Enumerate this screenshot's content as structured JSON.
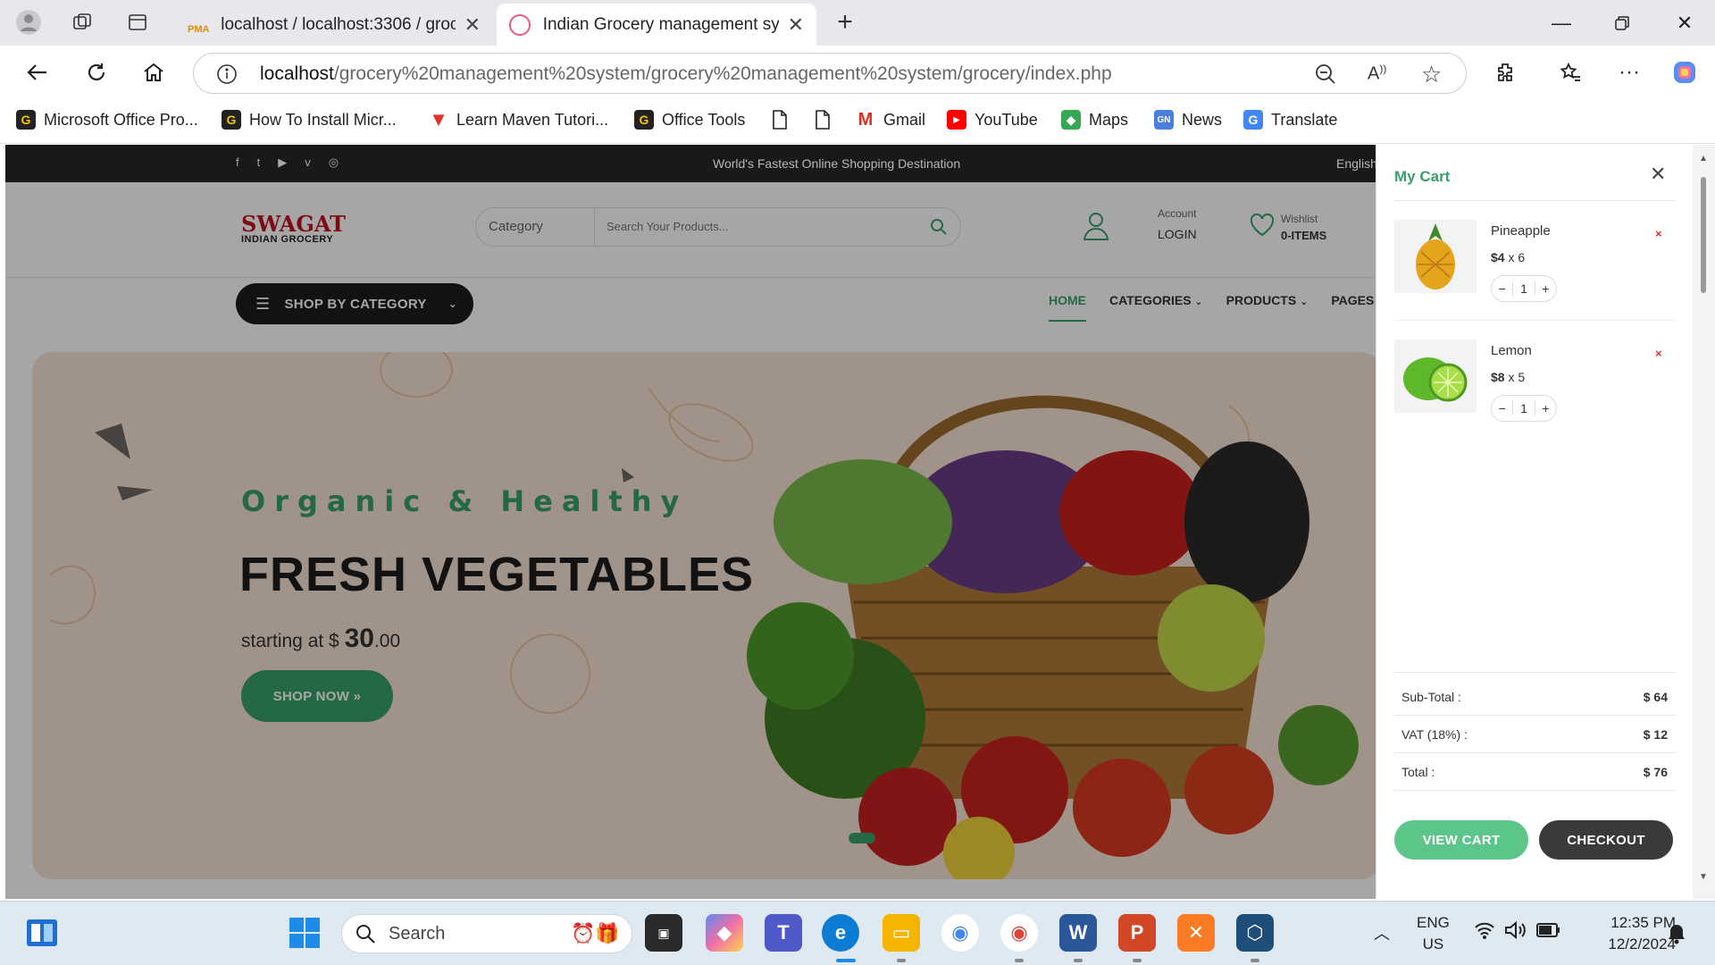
{
  "browser": {
    "tabs": [
      {
        "title": "localhost / localhost:3306 / groce"
      },
      {
        "title": "Indian Grocery management syste"
      }
    ],
    "url_host": "localhost",
    "url_path": "/grocery%20management%20system/grocery%20management%20system/grocery/index.php",
    "bookmarks": [
      {
        "label": "Microsoft Office Pro...",
        "icon": "g-icon"
      },
      {
        "label": "How To Install Micr...",
        "icon": "g-icon"
      },
      {
        "label": "Learn Maven Tutori...",
        "icon": "v-icon"
      },
      {
        "label": "Office Tools",
        "icon": "g-icon"
      },
      {
        "label": "",
        "icon": "file-icon"
      },
      {
        "label": "",
        "icon": "file-icon"
      },
      {
        "label": "Gmail",
        "icon": "gmail-icon"
      },
      {
        "label": "YouTube",
        "icon": "youtube-icon"
      },
      {
        "label": "Maps",
        "icon": "maps-icon"
      },
      {
        "label": "News",
        "icon": "news-icon"
      },
      {
        "label": "Translate",
        "icon": "translate-icon"
      }
    ]
  },
  "site": {
    "tagline": "World's Fastest Online Shopping Destination",
    "language": "English",
    "logo_main": "SWAGAT",
    "logo_sub": "INDIAN GROCERY",
    "search_category": "Category",
    "search_placeholder": "Search Your Products...",
    "account_label": "Account",
    "account_action": "LOGIN",
    "wishlist_label": "Wishlist",
    "wishlist_count": "0-ITEMS",
    "shop_by_category": "SHOP BY CATEGORY",
    "nav": [
      {
        "label": "HOME"
      },
      {
        "label": "CATEGORIES"
      },
      {
        "label": "PRODUCTS"
      },
      {
        "label": "PAGES"
      }
    ],
    "hero": {
      "eyebrow": "Organic & Healthy",
      "title": "FRESH VEGETABLES",
      "starting_prefix": "starting at $",
      "price_main": "30",
      "price_cents": ".00",
      "cta": "SHOP NOW »"
    }
  },
  "cart": {
    "title": "My Cart",
    "items": [
      {
        "name": "Pineapple",
        "price": "$4",
        "mult": "x 6",
        "qty": "1"
      },
      {
        "name": "Lemon",
        "price": "$8",
        "mult": "x 5",
        "qty": "1"
      }
    ],
    "summary": [
      {
        "label": "Sub-Total :",
        "value": "$ 64"
      },
      {
        "label": "VAT (18%) :",
        "value": "$ 12"
      },
      {
        "label": "Total :",
        "value": "$ 76"
      }
    ],
    "view_cart": "VIEW CART",
    "checkout": "CHECKOUT"
  },
  "taskbar": {
    "search_placeholder": "Search",
    "lang_top": "ENG",
    "lang_bottom": "US",
    "time": "12:35 PM",
    "date": "12/2/2024"
  },
  "colors": {
    "brand_green": "#3aa06a",
    "dark": "#1c1c1c",
    "remove_red": "#e03030"
  }
}
